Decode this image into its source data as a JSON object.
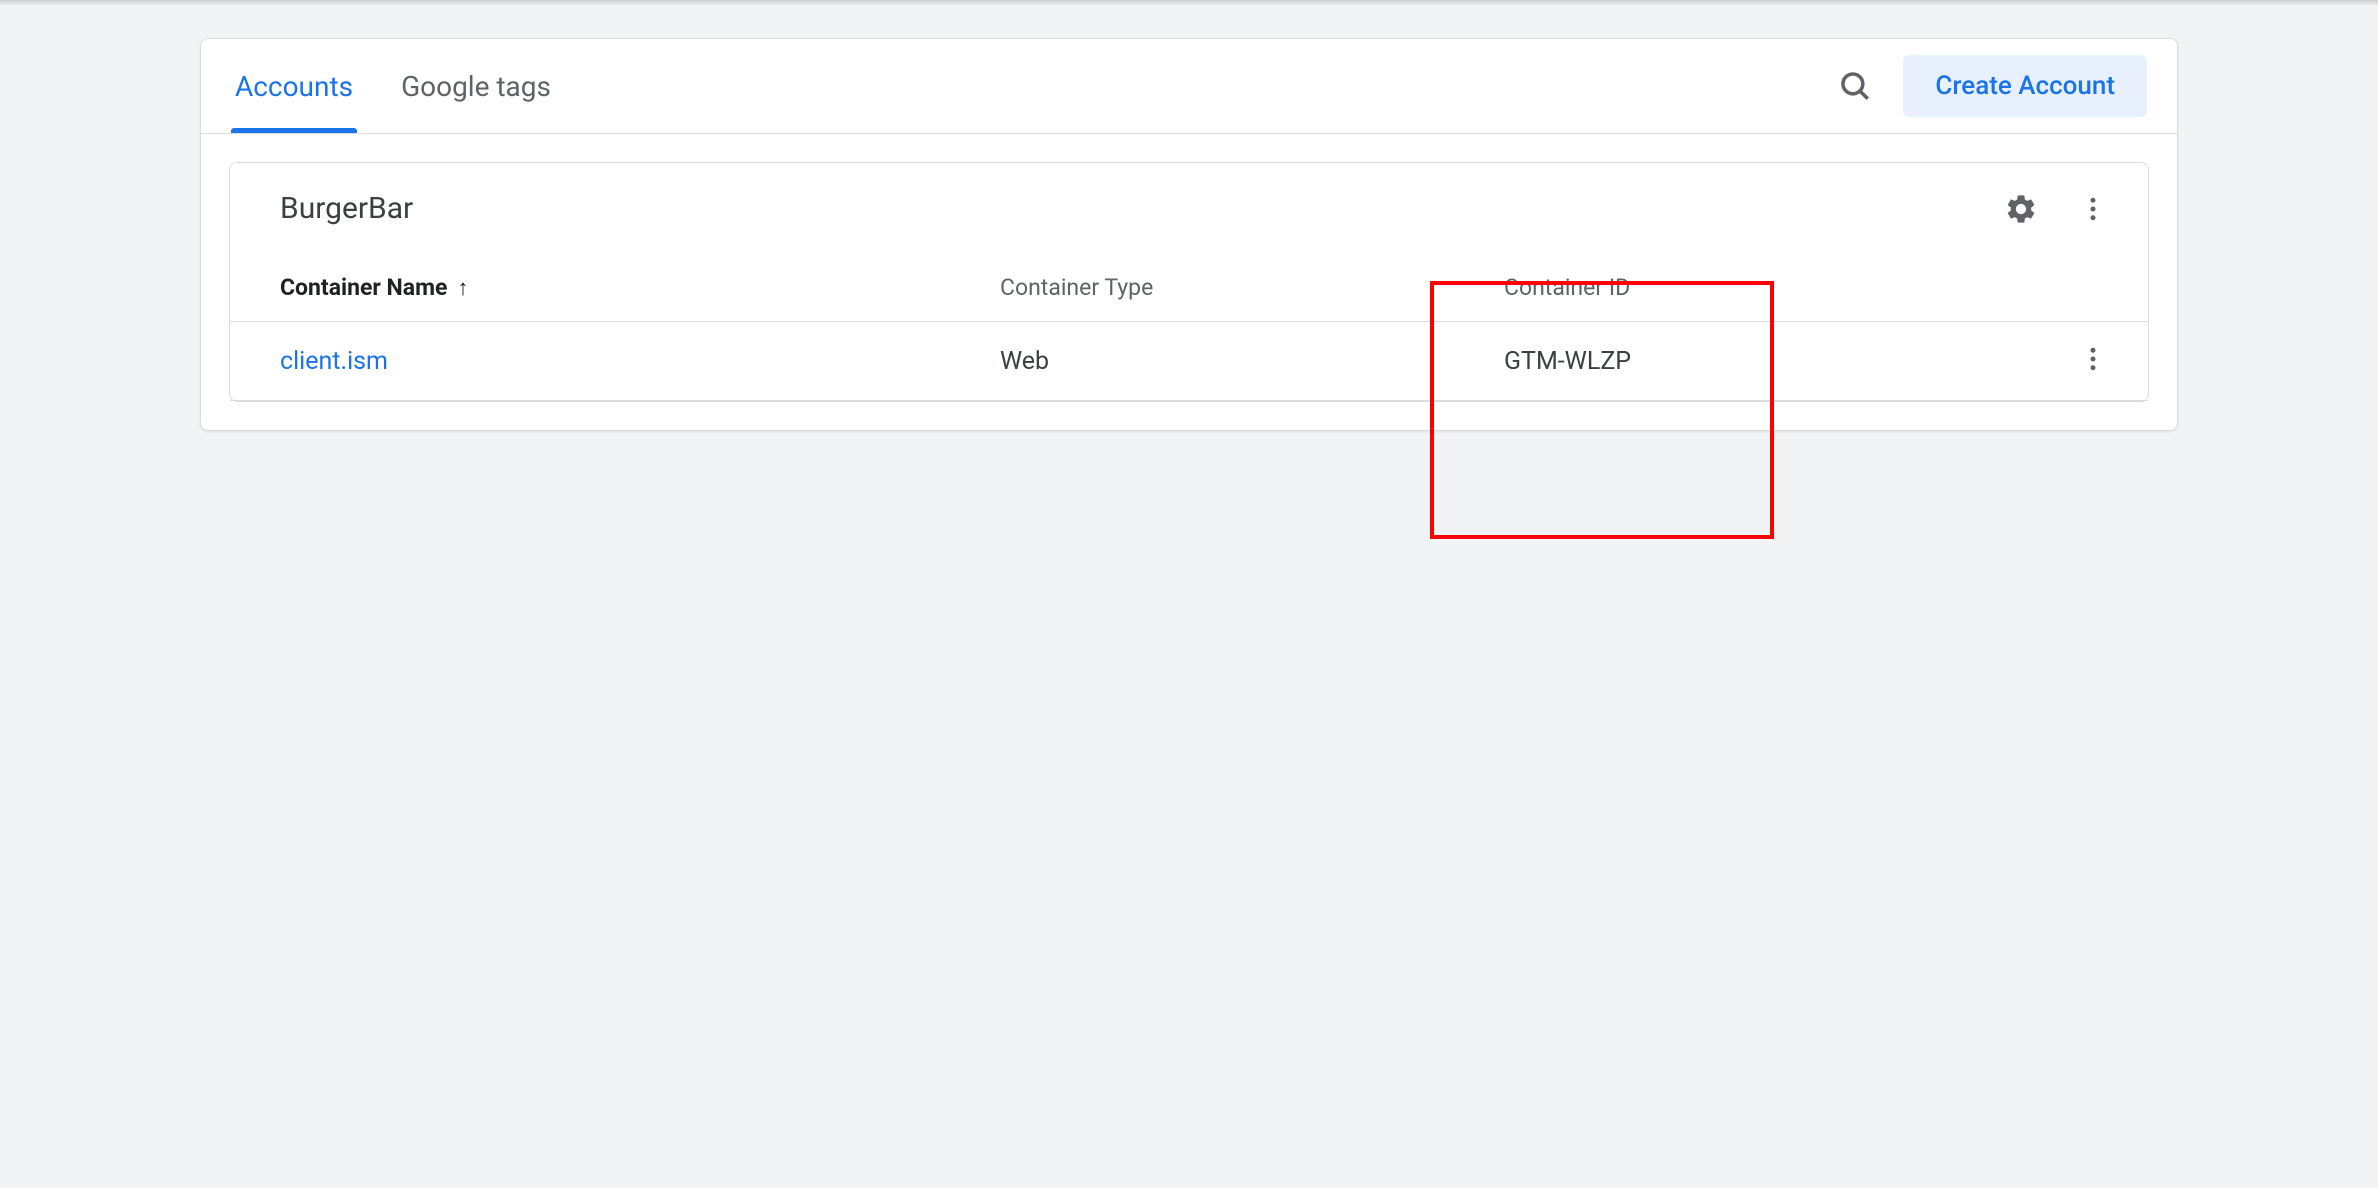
{
  "tabs": {
    "accounts": "Accounts",
    "google_tags": "Google tags"
  },
  "header": {
    "create_button": "Create Account"
  },
  "account": {
    "name": "BurgerBar",
    "columns": {
      "container_name": "Container Name",
      "container_type": "Container Type",
      "container_id": "Container ID"
    },
    "rows": [
      {
        "name": "client.ism",
        "type": "Web",
        "id": "GTM-WLZP"
      }
    ]
  }
}
